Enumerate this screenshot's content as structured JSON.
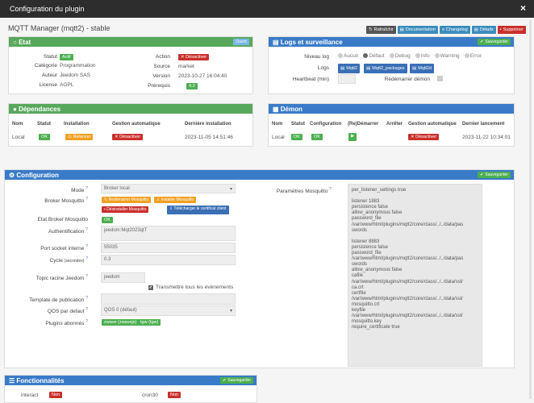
{
  "window": {
    "title": "Configuration du plugin",
    "close": "×"
  },
  "plugin_title": "MQTT Manager (mqtt2) - stable",
  "top_buttons": {
    "refresh": "Rafraîchir",
    "documentation": "Documentation",
    "changelog": "Changelog",
    "details": "Détails",
    "delete": "Supprimer"
  },
  "etat": {
    "header": "Etat",
    "header_btn": "Ouvrir",
    "statut_label": "Statut",
    "statut_value": "Actif",
    "categorie_label": "Catégorie",
    "categorie_value": "Programmation",
    "auteur_label": "Auteur",
    "auteur_value": "Jeedom SAS",
    "licence_label": "License",
    "licence_value": "AGPL",
    "action_label": "Action",
    "action_value": "Désactiver",
    "source_label": "Source",
    "source_value": "market",
    "version_label": "Version",
    "version_value": "2023-10-27 16:04:40",
    "prerequis_label": "Prérequis",
    "prerequis_value": "4.2"
  },
  "logs": {
    "header": "Logs et surveillance",
    "save": "Sauvegarder",
    "niveau_label": "Niveau log",
    "levels": [
      "Aucun",
      "Défaut",
      "Debug",
      "Info",
      "Warning",
      "Error"
    ],
    "logs_label": "Logs",
    "log_buttons": [
      "Mqtt2",
      "Mqtt2_packages",
      "Mqtt2d"
    ],
    "heartbeat_label": "Heartbeat (min)",
    "restart_label": "Redémarrer démon"
  },
  "dependances": {
    "header": "Dépendances",
    "cols": [
      "Nom",
      "Statut",
      "Installation",
      "Gestion automatique",
      "Dernière installation"
    ],
    "row": {
      "nom": "Local",
      "statut": "OK",
      "install": "Relancer",
      "gestion": "Désactiver",
      "derniere": "2023-11-05 14:51:46"
    }
  },
  "demon": {
    "header": "Démon",
    "cols": [
      "Nom",
      "Statut",
      "Configuration",
      "(Re)Démarrer",
      "Arrêter",
      "Gestion automatique",
      "Dernier lancement"
    ],
    "row": {
      "nom": "Local",
      "statut": "OK",
      "config": "OK",
      "gestion": "Désactiver",
      "dernier": "2023-11-22 10:34:01"
    }
  },
  "configuration": {
    "header": "Configuration",
    "save": "Sauvegarder",
    "mode_label": "Mode",
    "mode_value": "Broker local",
    "broker_label": "Broker Mosquitto",
    "broker_btns": {
      "restart": "Redémarrer Mosquitto",
      "install": "Installer Mosquitto",
      "uninstall": "Désinstaller Mosquitto",
      "download": "Télécharger le certificat client"
    },
    "etat_broker_label": "Etat Broker Mosquitto",
    "etat_broker_value": "OK",
    "auth_label": "Authentification",
    "auth_value": "jeedom:Mqt2023qtT",
    "port_label": "Port socket interne",
    "port_value": "55035",
    "cycle_label": "Cycle",
    "cycle_unit": "(secondes)",
    "cycle_value": "0.3",
    "topic_label": "Topic racine Jeedom",
    "topic_value": "jeedom",
    "transmit_label": "Transmettre tous les évènements",
    "template_label": "Template de publication",
    "qos_label": "QOS par defaut",
    "qos_value": "QOS 0 (défaut)",
    "plugins_label": "Plugins abonnés",
    "plugins": [
      "zwave (zwavejs)",
      "tgw (tgw)"
    ],
    "params_label": "Paramètres Mosquitto",
    "params_value": "per_listener_settings true\n\nlistener 1883\npersistence false\nallow_anonymous false\npassword_file\n/var/www/html/plugins/mqtt2/core/class/../../data/pas\nswords\n\nlistener 8883\npersistence false\npassword_file\n/var/www/html/plugins/mqtt2/core/class/../../data/pas\nswords\nallow_anonymous false\ncafile\n/var/www/html/plugins/mqtt2/core/class/../../data/ssl/\nca.crt\ncertfile\n/var/www/html/plugins/mqtt2/core/class/../../data/ssl/\nmosquitto.crt\nkeyfile\n/var/www/html/plugins/mqtt2/core/class/../../data/ssl/\nmosquitto.key\nrequire_certificate true"
  },
  "fonctionnalites": {
    "header": "Fonctionnalités",
    "save": "Sauvegarder",
    "interact_label": "interact",
    "interact_value": "Non",
    "cron30_label": "cron30",
    "cron30_value": "Non"
  }
}
